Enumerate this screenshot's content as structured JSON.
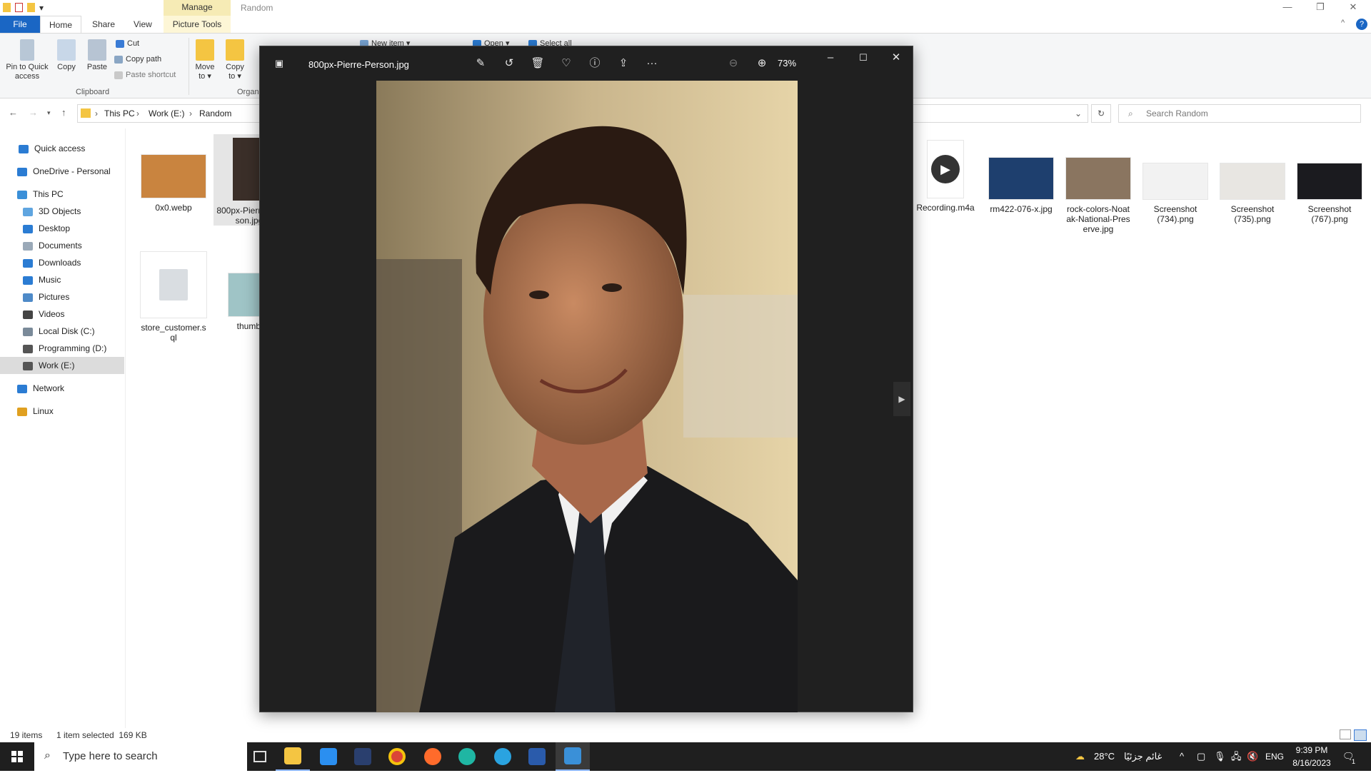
{
  "window": {
    "title": "Random",
    "context_tab": "Manage"
  },
  "tabs": {
    "file": "File",
    "home": "Home",
    "share": "Share",
    "view": "View",
    "picture_tools": "Picture Tools"
  },
  "ribbon": {
    "pin": "Pin to Quick\naccess",
    "copy": "Copy",
    "paste": "Paste",
    "cut": "Cut",
    "copy_path": "Copy path",
    "paste_shortcut": "Paste shortcut",
    "move_to": "Move\nto ▾",
    "copy_to": "Copy\nto ▾",
    "new_item": "New item ▾",
    "open": "Open ▾",
    "select_all": "Select all",
    "group_clipboard": "Clipboard",
    "group_organize": "Organ"
  },
  "address": {
    "crumbs": [
      "This PC",
      "Work (E:)",
      "Random"
    ],
    "search_placeholder": "Search Random"
  },
  "nav": [
    {
      "label": "Quick access",
      "icon": "star-icon",
      "color": "#2b7cd3"
    },
    {
      "label": "OneDrive - Personal",
      "icon": "cloud-icon",
      "color": "#2b7cd3"
    },
    {
      "label": "This PC",
      "icon": "computer-icon",
      "color": "#3a8fd8"
    },
    {
      "label": "3D Objects",
      "icon": "cube-icon",
      "color": "#5fa5e0"
    },
    {
      "label": "Desktop",
      "icon": "desktop-icon",
      "color": "#2b7cd3"
    },
    {
      "label": "Documents",
      "icon": "documents-icon",
      "color": "#9aa9b8"
    },
    {
      "label": "Downloads",
      "icon": "download-icon",
      "color": "#2b7cd3"
    },
    {
      "label": "Music",
      "icon": "music-icon",
      "color": "#2b7cd3"
    },
    {
      "label": "Pictures",
      "icon": "pictures-icon",
      "color": "#4e8ac8"
    },
    {
      "label": "Videos",
      "icon": "videos-icon",
      "color": "#444"
    },
    {
      "label": "Local Disk (C:)",
      "icon": "drive-icon",
      "color": "#7a8a99"
    },
    {
      "label": "Programming (D:)",
      "icon": "drive-icon",
      "color": "#555"
    },
    {
      "label": "Work (E:)",
      "icon": "drive-icon",
      "color": "#555"
    },
    {
      "label": "Network",
      "icon": "network-icon",
      "color": "#2b7cd3"
    },
    {
      "label": "Linux",
      "icon": "linux-icon",
      "color": "#e0a020"
    }
  ],
  "files_left": [
    {
      "name": "0x0.webp",
      "thumb": "#c9843f"
    },
    {
      "name": "800px-Pierre-Per\nson.jpg",
      "thumb": "#3b2f29"
    },
    {
      "name": "store_customer.s\nql",
      "thumb": "#d9dde1"
    },
    {
      "name": "thumb.",
      "thumb": "#9fc4c6"
    }
  ],
  "files_right": [
    {
      "name": "Recording.m4a",
      "thumb": "#fff"
    },
    {
      "name": "rm422-076-x.jpg",
      "thumb": "#1e3f6e"
    },
    {
      "name": "rock-colors-Noat\nak-National-Pres\nerve.jpg",
      "thumb": "#8a7560"
    },
    {
      "name": "Screenshot\n(734).png",
      "thumb": "#f2f2f2"
    },
    {
      "name": "Screenshot\n(735).png",
      "thumb": "#e8e6e2"
    },
    {
      "name": "Screenshot\n(767).png",
      "thumb": "#1b1b1f"
    }
  ],
  "status": {
    "items": "19 items",
    "selected": "1 item selected  169 KB"
  },
  "viewer": {
    "filename": "800px-Pierre-Person.jpg",
    "zoom": "73%"
  },
  "taskbar": {
    "search_placeholder": "Type here to search",
    "weather": "28°C",
    "weather_text": "غائم جزئيًا",
    "lang": "ENG",
    "time": "9:39 PM",
    "date": "8/16/2023",
    "notif": "1"
  }
}
